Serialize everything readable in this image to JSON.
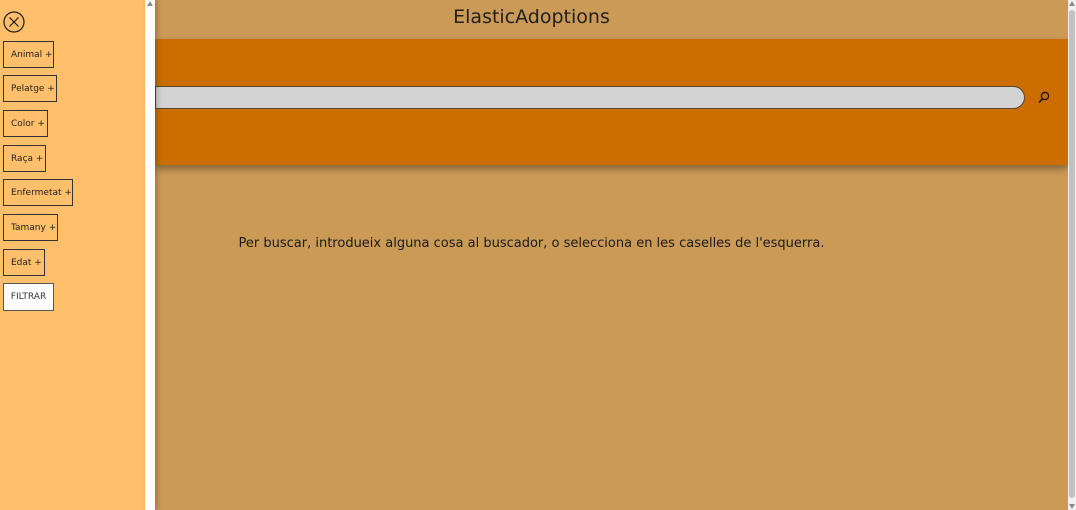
{
  "header": {
    "title": "ElasticAdoptions"
  },
  "search": {
    "value": "",
    "placeholder": "",
    "button_icon": "search-icon"
  },
  "main": {
    "info_message": "Per buscar, introdueix alguna cosa al buscador, o selecciona en les caselles de l'esquerra."
  },
  "sidebar": {
    "close_icon": "close-circle-icon",
    "filters": [
      {
        "label": "Animal +"
      },
      {
        "label": "Pelatge +"
      },
      {
        "label": "Color +"
      },
      {
        "label": "Raça +"
      },
      {
        "label": "Enfermetat +"
      },
      {
        "label": "Tamany +"
      },
      {
        "label": "Edat +"
      }
    ],
    "submit_label": "FILTRAR"
  },
  "colors": {
    "page_background": "#cc9a57",
    "search_band": "#cc6d00",
    "sidebar_background": "#ffbf6b",
    "search_input": "#d3d3d3"
  }
}
